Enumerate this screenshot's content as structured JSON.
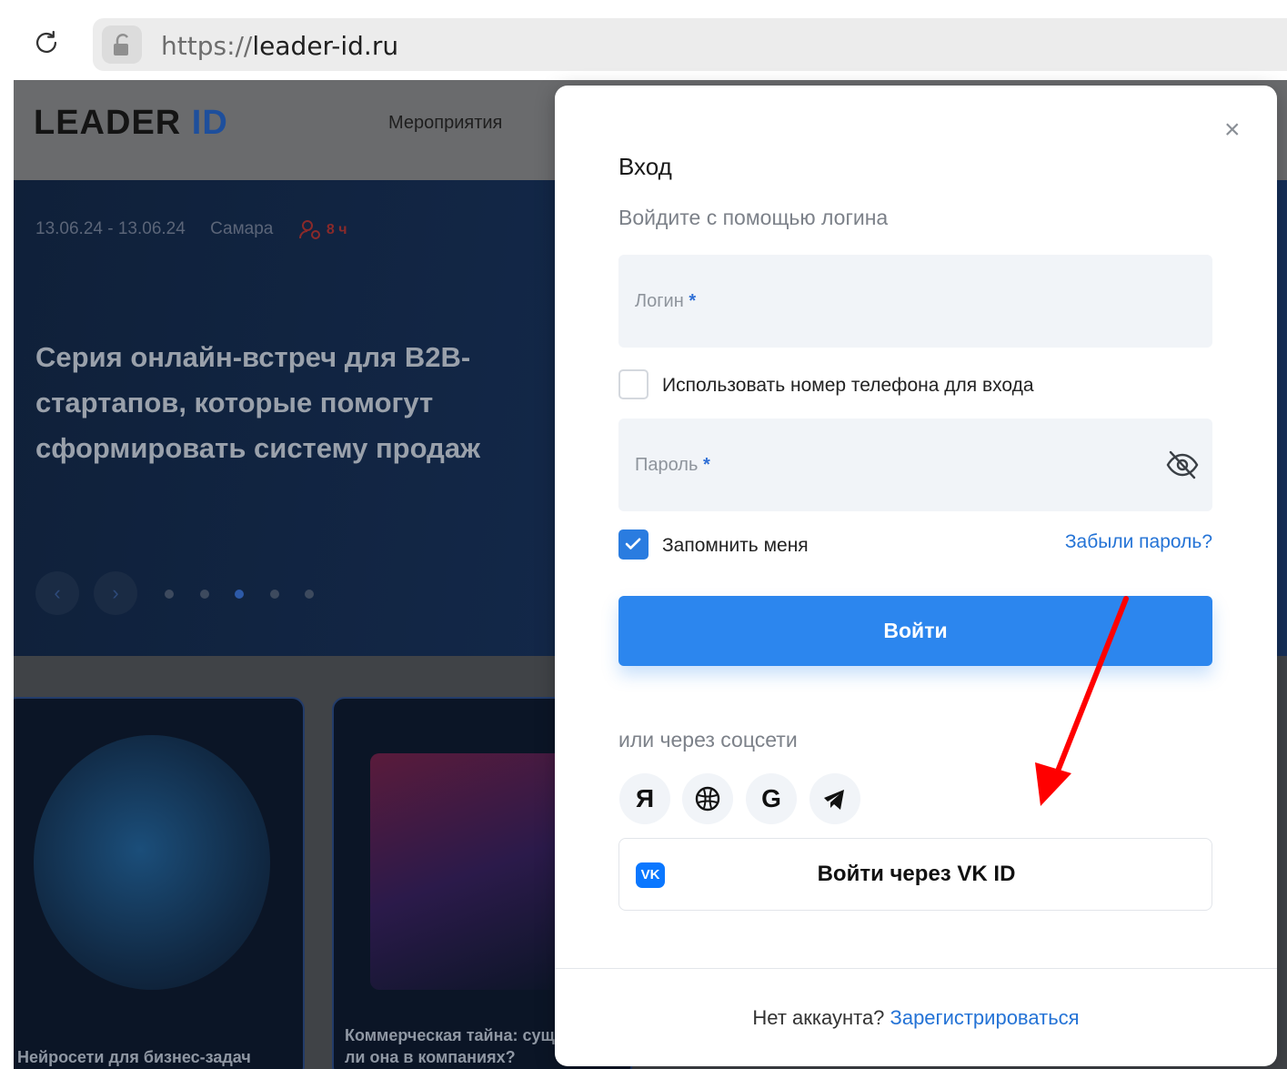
{
  "browser": {
    "url_protocol": "https://",
    "url_host": "leader-id.ru"
  },
  "site": {
    "logo_text": "LEADER",
    "logo_accent": "ID",
    "nav_events": "Мероприятия",
    "hero": {
      "dates": "13.06.24 - 13.06.24",
      "city": "Самара",
      "duration": "8 ч",
      "title": "Серия онлайн-встреч для B2B-стартапов, которые помогут сформировать систему продаж",
      "prev_arrow": "‹",
      "next_arrow": "›"
    },
    "cards": [
      {
        "title": "Нейросети для бизнес-задач"
      },
      {
        "title": "Коммерческая тайна: существует ли она в компаниях?"
      }
    ]
  },
  "modal": {
    "close": "×",
    "title": "Вход",
    "subtitle": "Войдите с помощью логина",
    "login_placeholder": "Логин",
    "required_mark": "*",
    "use_phone_label": "Использовать номер телефона для входа",
    "password_placeholder": "Пароль",
    "remember_label": "Запомнить меня",
    "forgot_link": "Забыли пароль?",
    "login_button": "Войти",
    "or_social": "или через соцсети",
    "social": [
      {
        "glyph": "Я",
        "icon": "yandex-icon"
      },
      {
        "glyph": "◎",
        "icon": "sber-icon"
      },
      {
        "glyph": "G",
        "icon": "google-icon"
      },
      {
        "glyph": "➤",
        "icon": "telegram-icon"
      }
    ],
    "vk_logo": "VK",
    "vk_button": "Войти через VK ID",
    "no_account": "Нет аккаунта?",
    "register_link": "Зарегистрироваться"
  },
  "colors": {
    "accent": "#2c86ee",
    "link": "#2473d6",
    "annotation_arrow": "#ff0000"
  }
}
